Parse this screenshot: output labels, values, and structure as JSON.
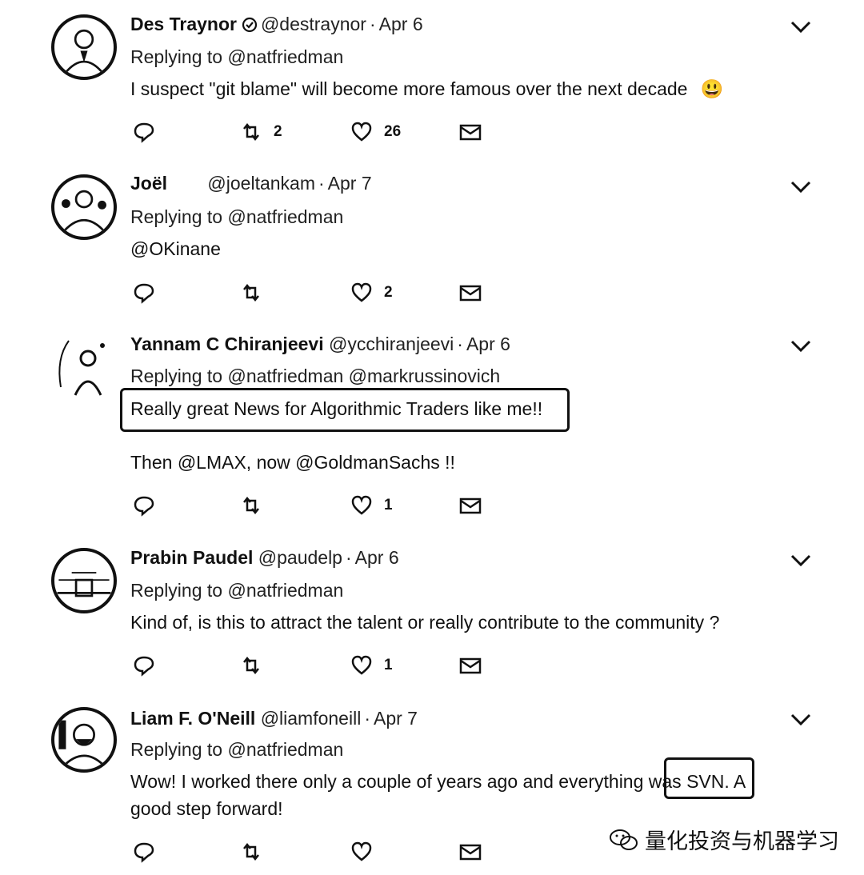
{
  "replies": [
    {
      "name": "Des Traynor",
      "verified": true,
      "handle": "@destraynor",
      "date": "Apr 6",
      "replying_prefix": "Replying to",
      "replying_to": "@natfriedman",
      "text": "I suspect \"git blame\" will become more famous over the next decade",
      "emoji": "😃",
      "retweets": "2",
      "likes": "26"
    },
    {
      "name": "Joël",
      "handle": "@joeltankam",
      "date": "Apr 7",
      "replying_prefix": "Replying to",
      "replying_to": "@natfriedman",
      "text": "@OKinane",
      "retweets": "",
      "likes": "2"
    },
    {
      "name": "Yannam C Chiranjeevi",
      "handle": "@ycchiranjeevi",
      "date": "Apr 6",
      "replying_prefix": "Replying to",
      "replying_to": "@natfriedman @markrussinovich",
      "text_line1": "Really great News for Algorithmic Traders like me!!",
      "text_line2": "Then @LMAX, now @GoldmanSachs !!",
      "retweets": "",
      "likes": "1"
    },
    {
      "name": "Prabin Paudel",
      "handle": "@paudelp",
      "date": "Apr 6",
      "replying_prefix": "Replying to",
      "replying_to": "@natfriedman",
      "text": "Kind of, is this to attract the talent or really contribute to the community ?",
      "retweets": "",
      "likes": "1"
    },
    {
      "name": "Liam F. O'Neill",
      "handle": "@liamfoneill",
      "date": "Apr 7",
      "replying_prefix": "Replying to",
      "replying_to": "@natfriedman",
      "text_before": "Wow! I worked there only a couple of years ago and everything ",
      "text_highlight": "was SVN.",
      "text_after": " A",
      "text_line2": "good step forward!",
      "retweets": "",
      "likes": ""
    }
  ],
  "watermark": "量化投资与机器学习"
}
